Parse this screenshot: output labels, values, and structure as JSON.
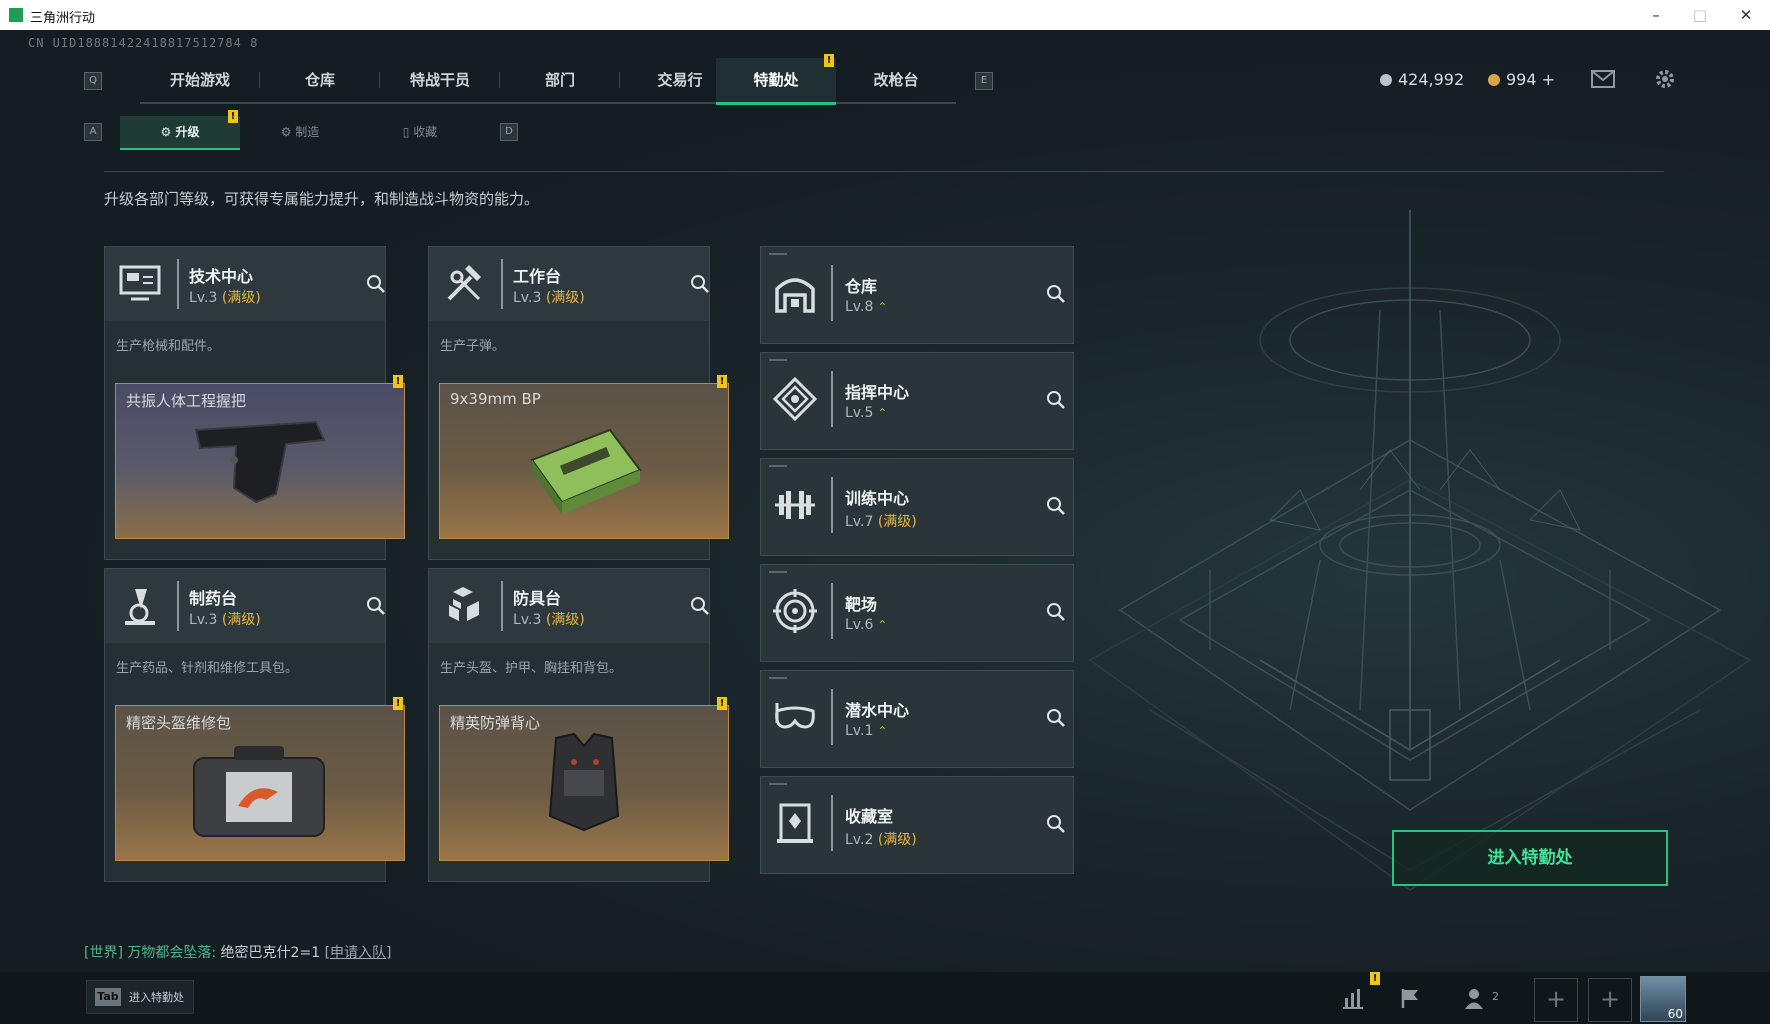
{
  "window": {
    "title": "三角洲行动",
    "min": "–",
    "max": "□",
    "close": "✕"
  },
  "uid": "CN UID18881422418817512784 8",
  "topnav": {
    "key_left": "Q",
    "key_right": "E",
    "tabs": [
      {
        "label": "开始游戏"
      },
      {
        "label": "仓库"
      },
      {
        "label": "特战干员"
      },
      {
        "label": "部门"
      },
      {
        "label": "交易行"
      },
      {
        "label": "特勤处",
        "active": true
      },
      {
        "label": "改枪台"
      }
    ],
    "badge": "!"
  },
  "currency": {
    "silver": "424,992",
    "gold": "994 +"
  },
  "subnav": {
    "key_left": "A",
    "key_right": "D",
    "tabs": [
      {
        "label": "升级",
        "active": true
      },
      {
        "label": "制造"
      },
      {
        "label": "收藏"
      }
    ],
    "badge": "!"
  },
  "description": "升级各部门等级，可获得专属能力提升，和制造战斗物资的能力。",
  "cards": [
    {
      "name": "技术中心",
      "lv": "Lv.3",
      "max": "(满级)",
      "desc": "生产枪械和配件。",
      "product": "共振人体工程握把",
      "badge": "!"
    },
    {
      "name": "工作台",
      "lv": "Lv.3",
      "max": "(满级)",
      "desc": "生产子弹。",
      "product": "9x39mm BP",
      "badge": "!"
    },
    {
      "name": "制药台",
      "lv": "Lv.3",
      "max": "(满级)",
      "desc": "生产药品、针剂和维修工具包。",
      "product": "精密头盔维修包",
      "badge": "!"
    },
    {
      "name": "防具台",
      "lv": "Lv.3",
      "max": "(满级)",
      "desc": "生产头盔、护甲、胸挂和背包。",
      "product": "精英防弹背心",
      "badge": "!"
    }
  ],
  "departments": [
    {
      "name": "仓库",
      "lv": "Lv.8",
      "max": "",
      "up": "⌃"
    },
    {
      "name": "指挥中心",
      "lv": "Lv.5",
      "max": "",
      "up": "⌃"
    },
    {
      "name": "训练中心",
      "lv": "Lv.7",
      "max": "(满级)",
      "up": ""
    },
    {
      "name": "靶场",
      "lv": "Lv.6",
      "max": "",
      "up": "⌃"
    },
    {
      "name": "潜水中心",
      "lv": "Lv.1",
      "max": "",
      "up": "⌃"
    },
    {
      "name": "收藏室",
      "lv": "Lv.2",
      "max": "(满级)",
      "up": ""
    }
  ],
  "enter_button": "进入特勤处",
  "chat": {
    "channel": "[世界]",
    "sender": "万物都会坠落:",
    "message": "绝密巴克什2=1",
    "link": "[申请入队]"
  },
  "bottom": {
    "tab_key": "Tab",
    "tab_label": "进入特勤处",
    "friends_count": "2",
    "avatar_level": "60",
    "badge": "!"
  },
  "colors": {
    "accent": "#26c47f",
    "max_level": "#e8b43a",
    "badge": "#f0c419"
  }
}
